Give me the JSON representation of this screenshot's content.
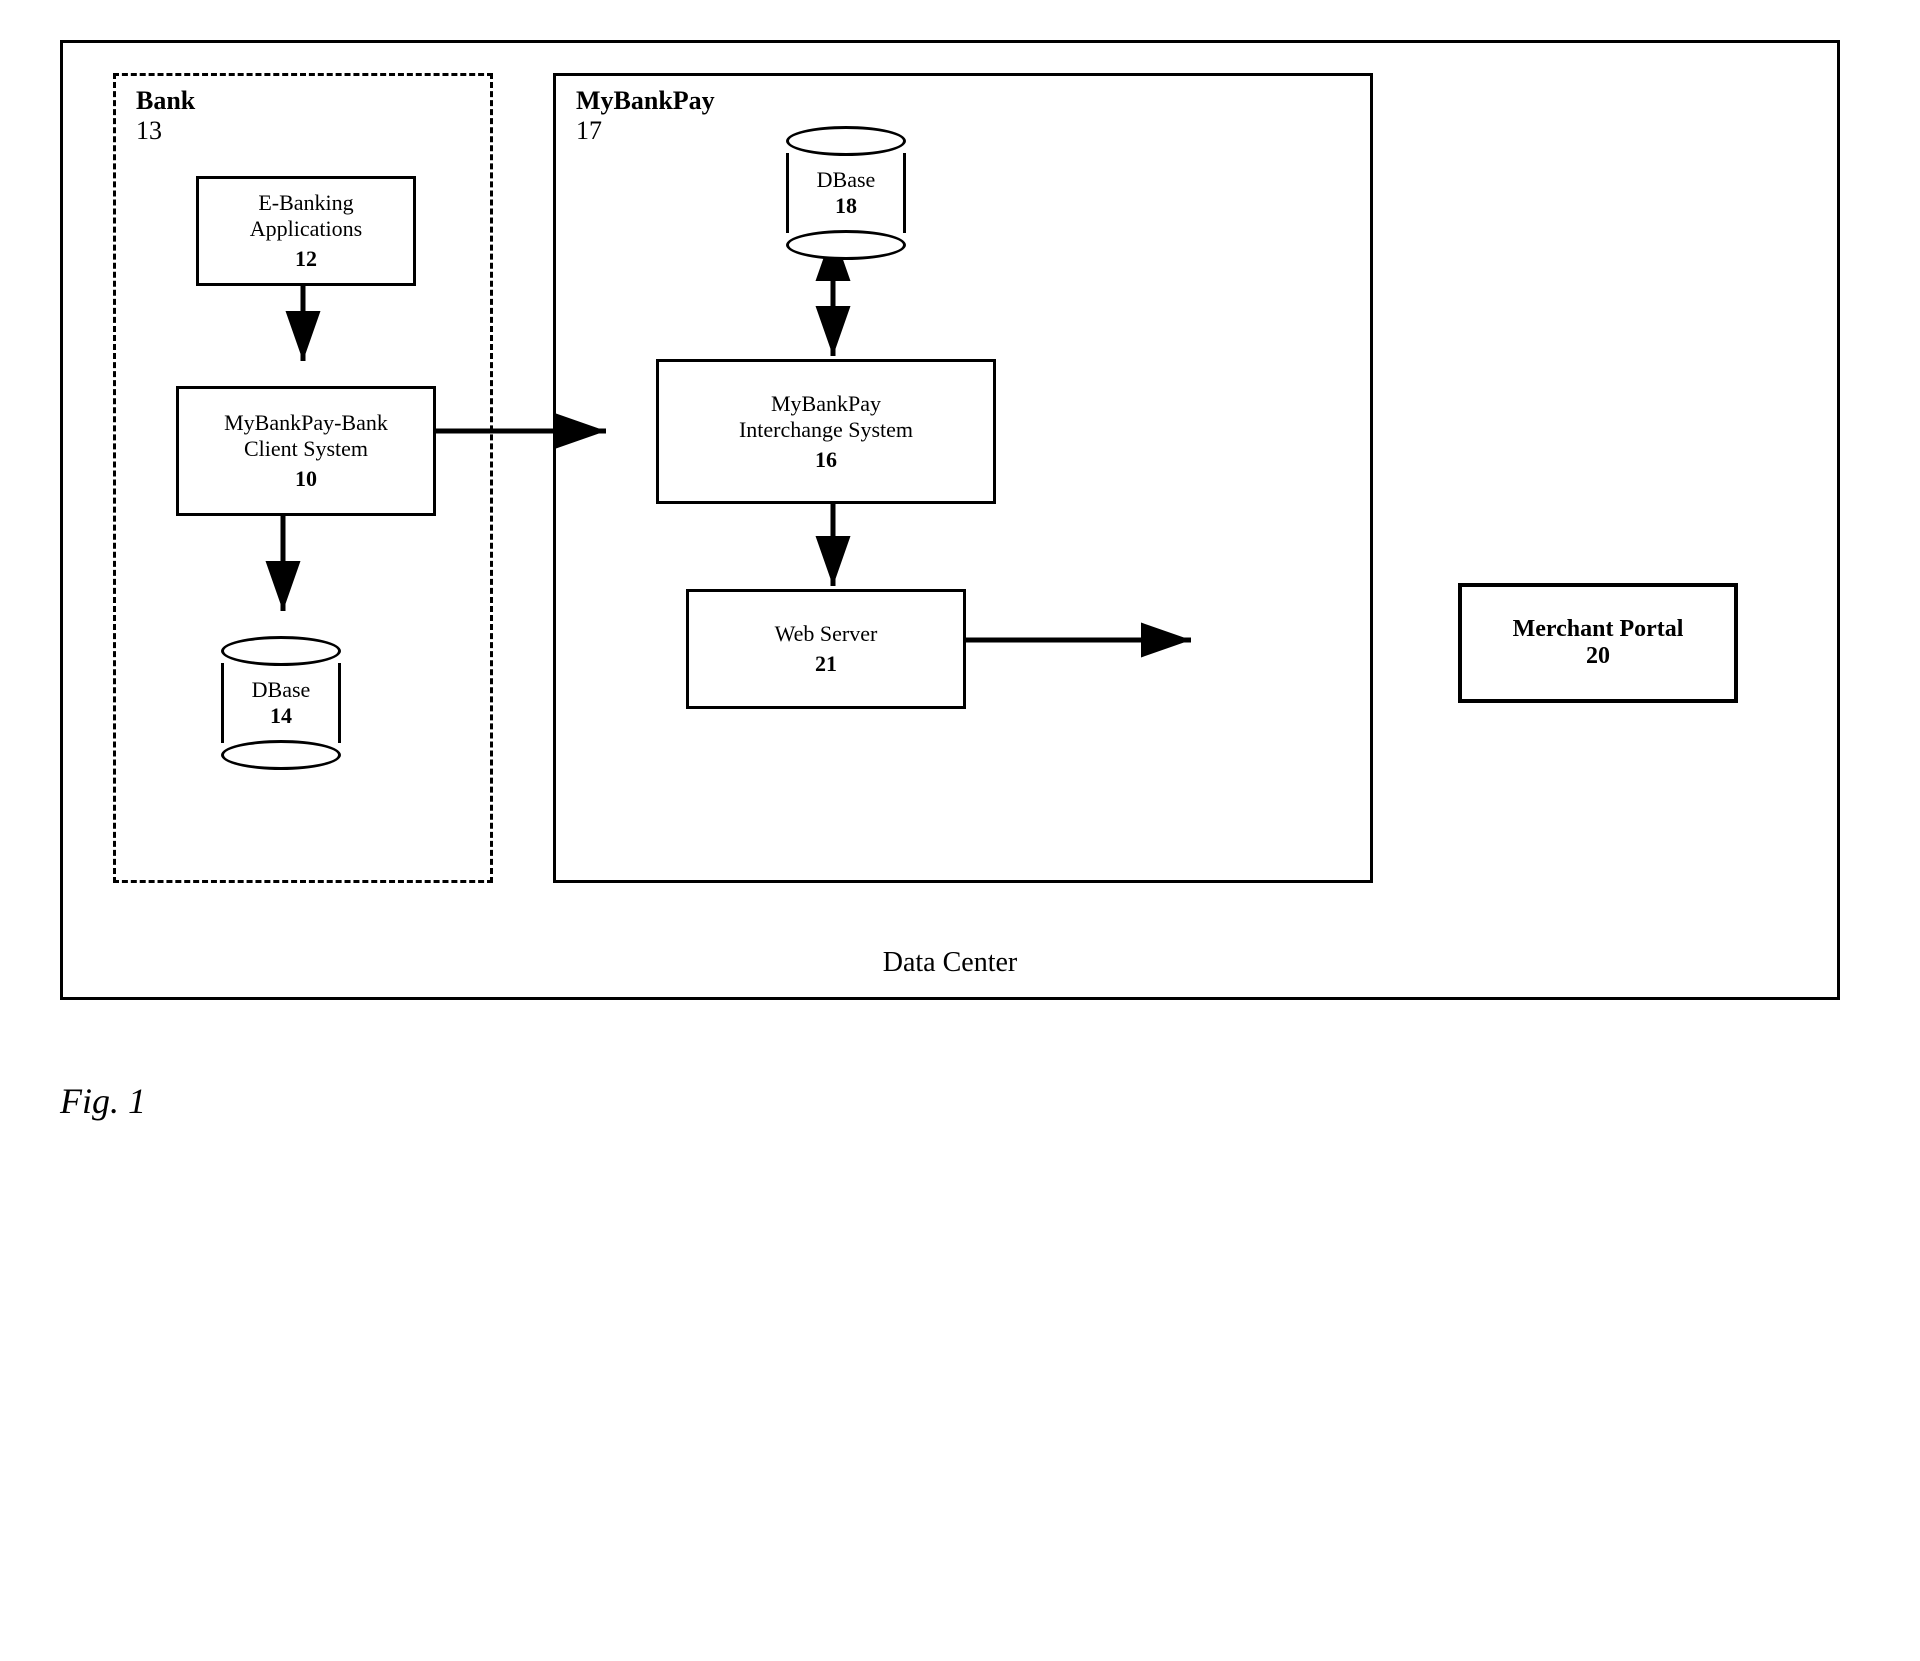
{
  "diagram": {
    "outer_border": "solid",
    "data_center_label": "Data Center",
    "fig_label": "Fig. 1",
    "bank": {
      "label": "Bank",
      "number": "13",
      "border_style": "dashed"
    },
    "mybankpay_section": {
      "label": "MyBankPay",
      "number": "17"
    },
    "components": {
      "ebanking": {
        "title": "E-Banking\nApplications",
        "number": "12"
      },
      "client_system": {
        "title": "MyBankPay-Bank\nClient System",
        "number": "10"
      },
      "dbase14": {
        "title": "DBase",
        "number": "14"
      },
      "dbase18": {
        "title": "DBase",
        "number": "18"
      },
      "interchange": {
        "title": "MyBankPay\nInterchange System",
        "number": "16"
      },
      "webserver": {
        "title": "Web Server",
        "number": "21"
      },
      "merchant_portal": {
        "title": "Merchant Portal",
        "number": "20",
        "bold": true
      }
    }
  }
}
